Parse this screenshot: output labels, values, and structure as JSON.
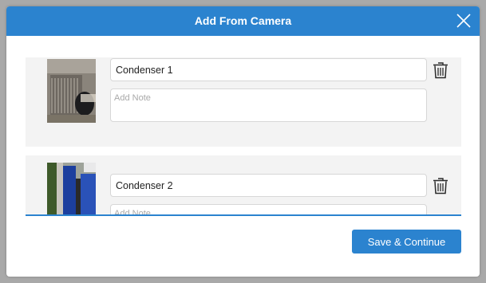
{
  "modal": {
    "title": "Add From Camera",
    "close_icon": "close-icon"
  },
  "items": [
    {
      "name": "Condenser 1",
      "note_placeholder": "Add Note",
      "note_value": "",
      "delete_icon": "trash-icon"
    },
    {
      "name": "Condenser 2",
      "note_placeholder": "Add Note",
      "note_value": "",
      "delete_icon": "trash-icon"
    }
  ],
  "footer": {
    "save_label": "Save & Continue"
  },
  "colors": {
    "accent": "#2b83cf",
    "item_background": "#f3f3f3",
    "overlay": "#a9a9a9"
  }
}
